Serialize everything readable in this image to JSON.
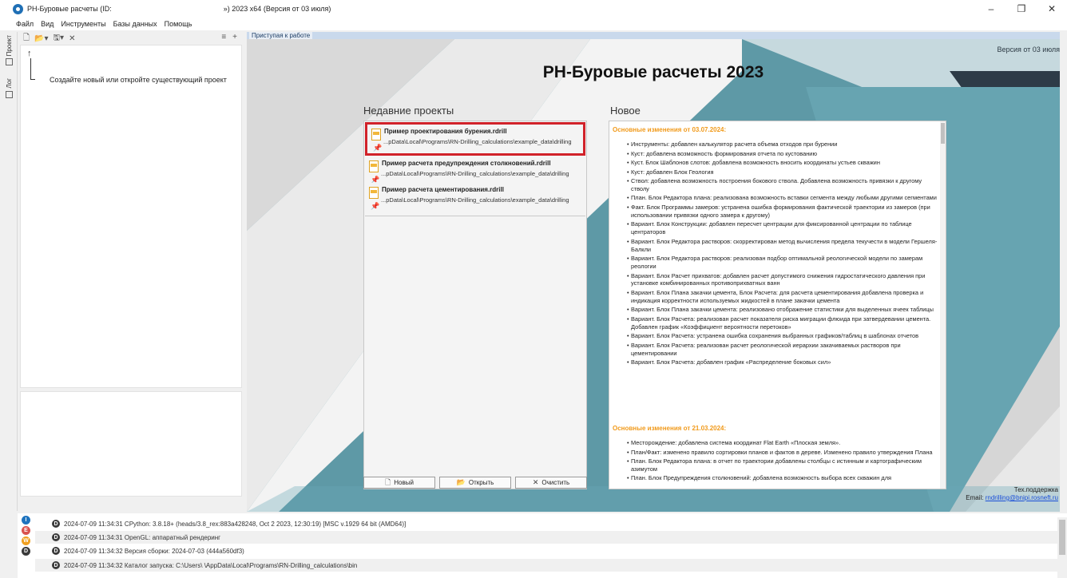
{
  "window": {
    "title_prefix": "РН-Буровые расчеты (ID:",
    "title_suffix": "») 2023 x64 (Версия от 03 июля)",
    "minimize": "–",
    "maximize": "❐",
    "close": "✕"
  },
  "menu": [
    "Файл",
    "Вид",
    "Инструменты",
    "Базы данных",
    "Помощь"
  ],
  "side_tabs": {
    "project": "Проект",
    "log": "Лог"
  },
  "project_pane": {
    "hint": "Создайте новый или откройте существующий проект"
  },
  "document_tab": "Приступая к работе",
  "start_page": {
    "title": "РН-Буровые расчеты 2023",
    "version_note": "Версия от 03 июля",
    "recent_heading": "Недавние проекты",
    "news_heading": "Новое",
    "recent_projects": [
      {
        "name": "Пример проектирования бурения.rdrill",
        "path": "...pData\\Local\\Programs\\RN-Drilling_calculations\\example_data\\drilling",
        "selected": true
      },
      {
        "name": "Пример расчета предупреждения столкновений.rdrill",
        "path": "...pData\\Local\\Programs\\RN-Drilling_calculations\\example_data\\drilling",
        "selected": false
      },
      {
        "name": "Пример расчета цементирования.rdrill",
        "path": "...pData\\Local\\Programs\\RN-Drilling_calculations\\example_data\\drilling",
        "selected": false
      }
    ],
    "buttons": {
      "new": "Новый",
      "open": "Открыть",
      "clear": "Очистить"
    },
    "news": [
      {
        "heading": "Основные изменения от 03.07.2024:",
        "items": [
          "Инструменты: добавлен калькулятор расчета объема отходов при бурении",
          "Куст: добавлена возможность формирования отчета по кустованию",
          "Куст. Блок Шаблонов слотов: добавлена возможность вносить координаты устьев скважин",
          "Куст: добавлен Блок Геология",
          "Ствол: добавлена возможность построения бокового ствола. Добавлена возможность привязки к другому стволу",
          "План. Блок Редактора плана: реализована возможность вставки сегмента между любыми другими сегментами",
          "Факт. Блок Программы замеров: устранена ошибка формирования фактической траектории из замеров (при использовании привязки одного замера к другому)",
          "Вариант. Блок Конструкции: добавлен пересчет центрации для фиксированной центрации по таблице центраторов",
          "Вариант. Блок Редактора растворов: скорректирован метод вычисления предела текучести в модели Гершеля-Балкли",
          "Вариант. Блок Редактора растворов: реализован подбор оптимальной реологической модели по замерам реологии",
          "Вариант. Блок Расчет прихватов: добавлен расчет допустимого снижения гидростатического давления при установке комбинированных противоприхватных ванн",
          "Вариант. Блок Плана закачки цемента, Блок Расчета: для расчета цементирования добавлена проверка и индикация корректности используемых жидкостей в плане закачки цемента",
          "Вариант. Блок Плана закачки цемента: реализовано отображение статистики для выделенных ячеек таблицы",
          "Вариант. Блок Расчета: реализован расчет показателя риска миграции флюида при затвердевании цемента. Добавлен график «Коэффициент вероятности перетоков»",
          "Вариант. Блок Расчета: устранена ошибка сохранения выбранных графиков/таблиц в шаблонах отчетов",
          "Вариант. Блок Расчета: реализован расчет реологической иерархии закачиваемых растворов при цементировании",
          "Вариант. Блок Расчета: добавлен график «Распределение боковых сил»"
        ]
      },
      {
        "heading": "Основные изменения от 21.03.2024:",
        "items": [
          "Месторождение: добавлена система координат Flat Earth «Плоская земля».",
          "План/Факт: изменено правило сортировки планов и фактов в дереве. Изменено правило утверждения Плана",
          "План. Блок Редактора плана: в отчет по траектории добавлены столбцы с истинным и картографическим азимутом",
          "План. Блок Предупреждения столкновений: добавлена возможность выбора всех скважин для"
        ]
      }
    ],
    "support": {
      "label": "Тех.поддержка",
      "email_label": "Email:",
      "email": "rndrilling@bnipi.rosneft.ru"
    }
  },
  "log": [
    {
      "level": "D",
      "text": "2024-07-09 11:34:31  CPython: 3.8.18+ (heads/3.8_rex:883a428248, Oct  2 2023, 12:30:19) [MSC v.1929 64 bit (AMD64)]"
    },
    {
      "level": "D",
      "text": "2024-07-09 11:34:31  OpenGL: аппаратный рендеринг"
    },
    {
      "level": "D",
      "text": "2024-07-09 11:34:32  Версия сборки: 2024-07-03 (444a560df3)"
    },
    {
      "level": "D",
      "text": "2024-07-09 11:34:32  Каталог запуска: C:\\Users\\                 \\AppData\\Local\\Programs\\RN-Drilling_calculations\\bin"
    }
  ],
  "log_levels": [
    "I",
    "E",
    "W",
    "D"
  ],
  "colors": {
    "accent_orange": "#f19a1b",
    "selection_red": "#d1222a",
    "teal_bg": "#5e99a6",
    "link_blue": "#1a4fd8"
  }
}
